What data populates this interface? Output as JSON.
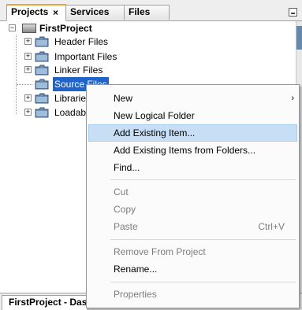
{
  "tabs": [
    {
      "label": "Projects",
      "close": "×"
    },
    {
      "label": "Services"
    },
    {
      "label": "Files"
    }
  ],
  "tree": {
    "project": {
      "label": "FirstProject",
      "expander": "−"
    },
    "items": [
      {
        "label": "Header Files",
        "expander": "+"
      },
      {
        "label": "Important Files",
        "expander": "+"
      },
      {
        "label": "Linker Files",
        "expander": "+"
      },
      {
        "label": "Source Files"
      },
      {
        "label": "Libraries",
        "expander": "+"
      },
      {
        "label": "Loadables",
        "expander": "+"
      }
    ]
  },
  "context_menu": {
    "items": [
      {
        "label": "New",
        "submenu_arrow": "›"
      },
      {
        "label": "New Logical Folder"
      },
      {
        "label": "Add Existing Item..."
      },
      {
        "label": "Add Existing Items from Folders..."
      },
      {
        "label": "Find..."
      },
      {
        "label": "Cut"
      },
      {
        "label": "Copy"
      },
      {
        "label": "Paste",
        "shortcut": "Ctrl+V"
      },
      {
        "label": "Remove From Project"
      },
      {
        "label": "Rename..."
      },
      {
        "label": "Properties"
      }
    ]
  },
  "bottom_panel": {
    "tab_label": "FirstProject - Dashboard"
  },
  "colors": {
    "selection": "#1f64c8",
    "menu_highlight": "#c7def5",
    "active_tab_accent": "#f0a040"
  }
}
